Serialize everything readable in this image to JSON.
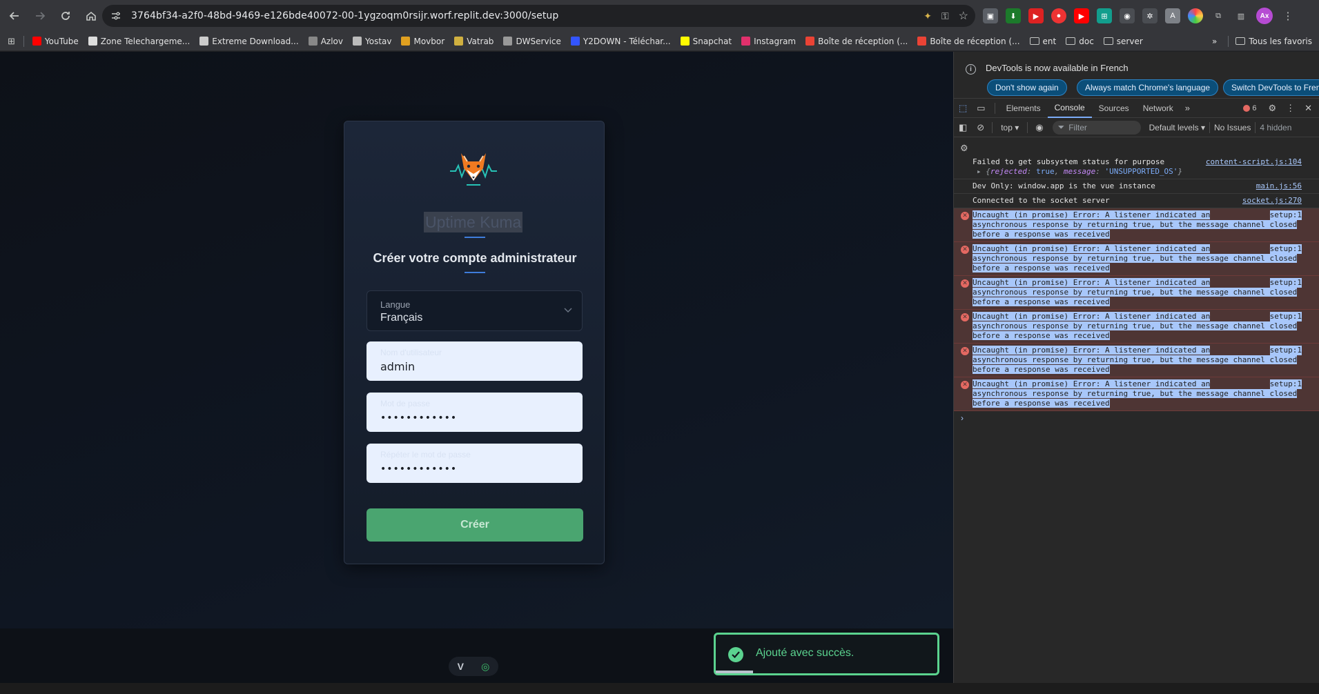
{
  "browser": {
    "url": "3764bf34-a2f0-48bd-9469-e126bde40072-00-1ygzoqm0rsijr.worf.replit.dev:3000/setup",
    "avatar_initials": "Ax",
    "bookmarks": [
      {
        "label": "YouTube",
        "color": "#ff0000"
      },
      {
        "label": "Zone Telechargeme...",
        "color": "#dddddd"
      },
      {
        "label": "Extreme Download...",
        "color": "#cccccc"
      },
      {
        "label": "Azlov",
        "color": "#888888"
      },
      {
        "label": "Yostav",
        "color": "#bbbbbb"
      },
      {
        "label": "Movbor",
        "color": "#e0a020"
      },
      {
        "label": "Vatrab",
        "color": "#d0b040"
      },
      {
        "label": "DWService",
        "color": "#999999"
      },
      {
        "label": "Y2DOWN - Téléchar...",
        "color": "#3355ff"
      },
      {
        "label": "Snapchat",
        "color": "#fffc00"
      },
      {
        "label": "Instagram",
        "color": "#e1306c"
      },
      {
        "label": "Boîte de réception (...",
        "color": "#ea4335"
      },
      {
        "label": "Boîte de réception (...",
        "color": "#ea4335"
      }
    ],
    "bookmark_folders": [
      "ent",
      "doc",
      "server"
    ],
    "all_bookmarks": "Tous les favoris"
  },
  "page": {
    "app_name": "Uptime Kuma",
    "title": "Créer votre compte administrateur",
    "language_label": "Langue",
    "language_value": "Français",
    "username_label": "Nom d'utilisateur",
    "username_value": "admin",
    "password_label": "Mot de passe",
    "password_value": "••••••••••••",
    "repeat_label": "Répéter le mot de passe",
    "repeat_value": "••••••••••••",
    "create_button": "Créer",
    "toast_message": "Ajouté avec succès."
  },
  "devtools": {
    "banner_text": "DevTools is now available in French",
    "banner_buttons": [
      "Don't show again",
      "Always match Chrome's language",
      "Switch DevTools to French"
    ],
    "tabs": [
      "Elements",
      "Console",
      "Sources",
      "Network"
    ],
    "active_tab": "Console",
    "error_count": "6",
    "context": "top",
    "filter_placeholder": "Filter",
    "levels": "Default levels",
    "issues": "No Issues",
    "hidden": "4 hidden",
    "logs": [
      {
        "text": "Failed to get subsystem status for purpose",
        "source": "content-script.js:104",
        "sub_key1": "rejected",
        "sub_val1": "true",
        "sub_key2": "message",
        "sub_val2": "'UNSUPPORTED_OS'"
      },
      {
        "text": "Dev Only: window.app is the vue instance",
        "source": "main.js:56"
      },
      {
        "text": "Connected to the socket server",
        "source": "socket.js:270"
      }
    ],
    "error_line1": "Uncaught (in promise) Error: A listener indicated an",
    "error_line2": "asynchronous response by returning true, but the message channel closed",
    "error_line3": "before a response was received",
    "error_source": "setup:1"
  }
}
